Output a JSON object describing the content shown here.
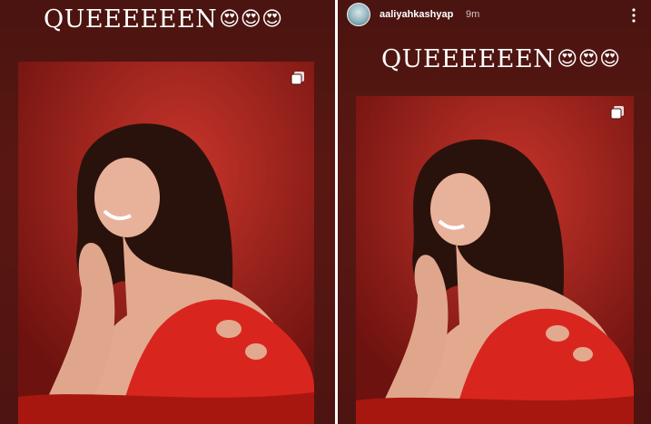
{
  "left_story": {
    "caption": "QUEEEEEEN",
    "emojis": "😍😍😍"
  },
  "right_story": {
    "username": "aaliyahkashyap",
    "timestamp": "9m",
    "caption": "QUEEEEEEN",
    "emojis": "😍😍😍"
  },
  "icons": {
    "multi_photo": "multiple-photos-icon",
    "more": "more-options-icon",
    "avatar": "profile-avatar"
  },
  "colors": {
    "story_background": "#4e1411",
    "photo_red": "#b2221c",
    "dress_red": "#d8261e",
    "text": "#ffffff"
  }
}
